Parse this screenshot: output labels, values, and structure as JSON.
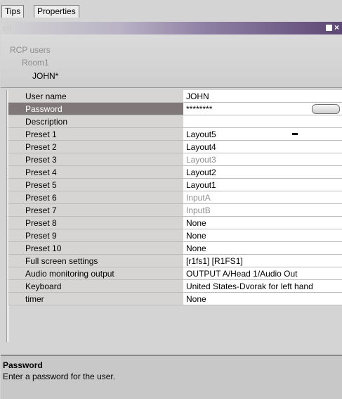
{
  "tabs": [
    {
      "label": "Tips"
    },
    {
      "label": "Properties"
    }
  ],
  "titlebar": {
    "grip": "::::",
    "close_glyph": "×"
  },
  "breadcrumb": [
    "RCP users",
    "Room1",
    "JOHN*"
  ],
  "properties": [
    {
      "key": "User name",
      "value": "JOHN"
    },
    {
      "key": "Password",
      "value": "********"
    },
    {
      "key": "Description",
      "value": ""
    },
    {
      "key": "Preset 1",
      "value": "Layout5"
    },
    {
      "key": "Preset 2",
      "value": "Layout4"
    },
    {
      "key": "Preset 3",
      "value": "Layout3"
    },
    {
      "key": "Preset 4",
      "value": "Layout2"
    },
    {
      "key": "Preset 5",
      "value": "Layout1"
    },
    {
      "key": "Preset 6",
      "value": "InputA"
    },
    {
      "key": "Preset 7",
      "value": "InputB"
    },
    {
      "key": "Preset 8",
      "value": "None"
    },
    {
      "key": "Preset 9",
      "value": "None"
    },
    {
      "key": "Preset 10",
      "value": "None"
    },
    {
      "key": "Full screen settings",
      "value": "[r1fs1] [R1FS1]"
    },
    {
      "key": "Audio monitoring output",
      "value": "OUTPUT A/Head 1/Audio Out"
    },
    {
      "key": "Keyboard",
      "value": "United States-Dvorak for left hand"
    },
    {
      "key": "timer",
      "value": "None"
    }
  ],
  "footer": {
    "title": "Password",
    "description": "Enter a password for the user."
  }
}
